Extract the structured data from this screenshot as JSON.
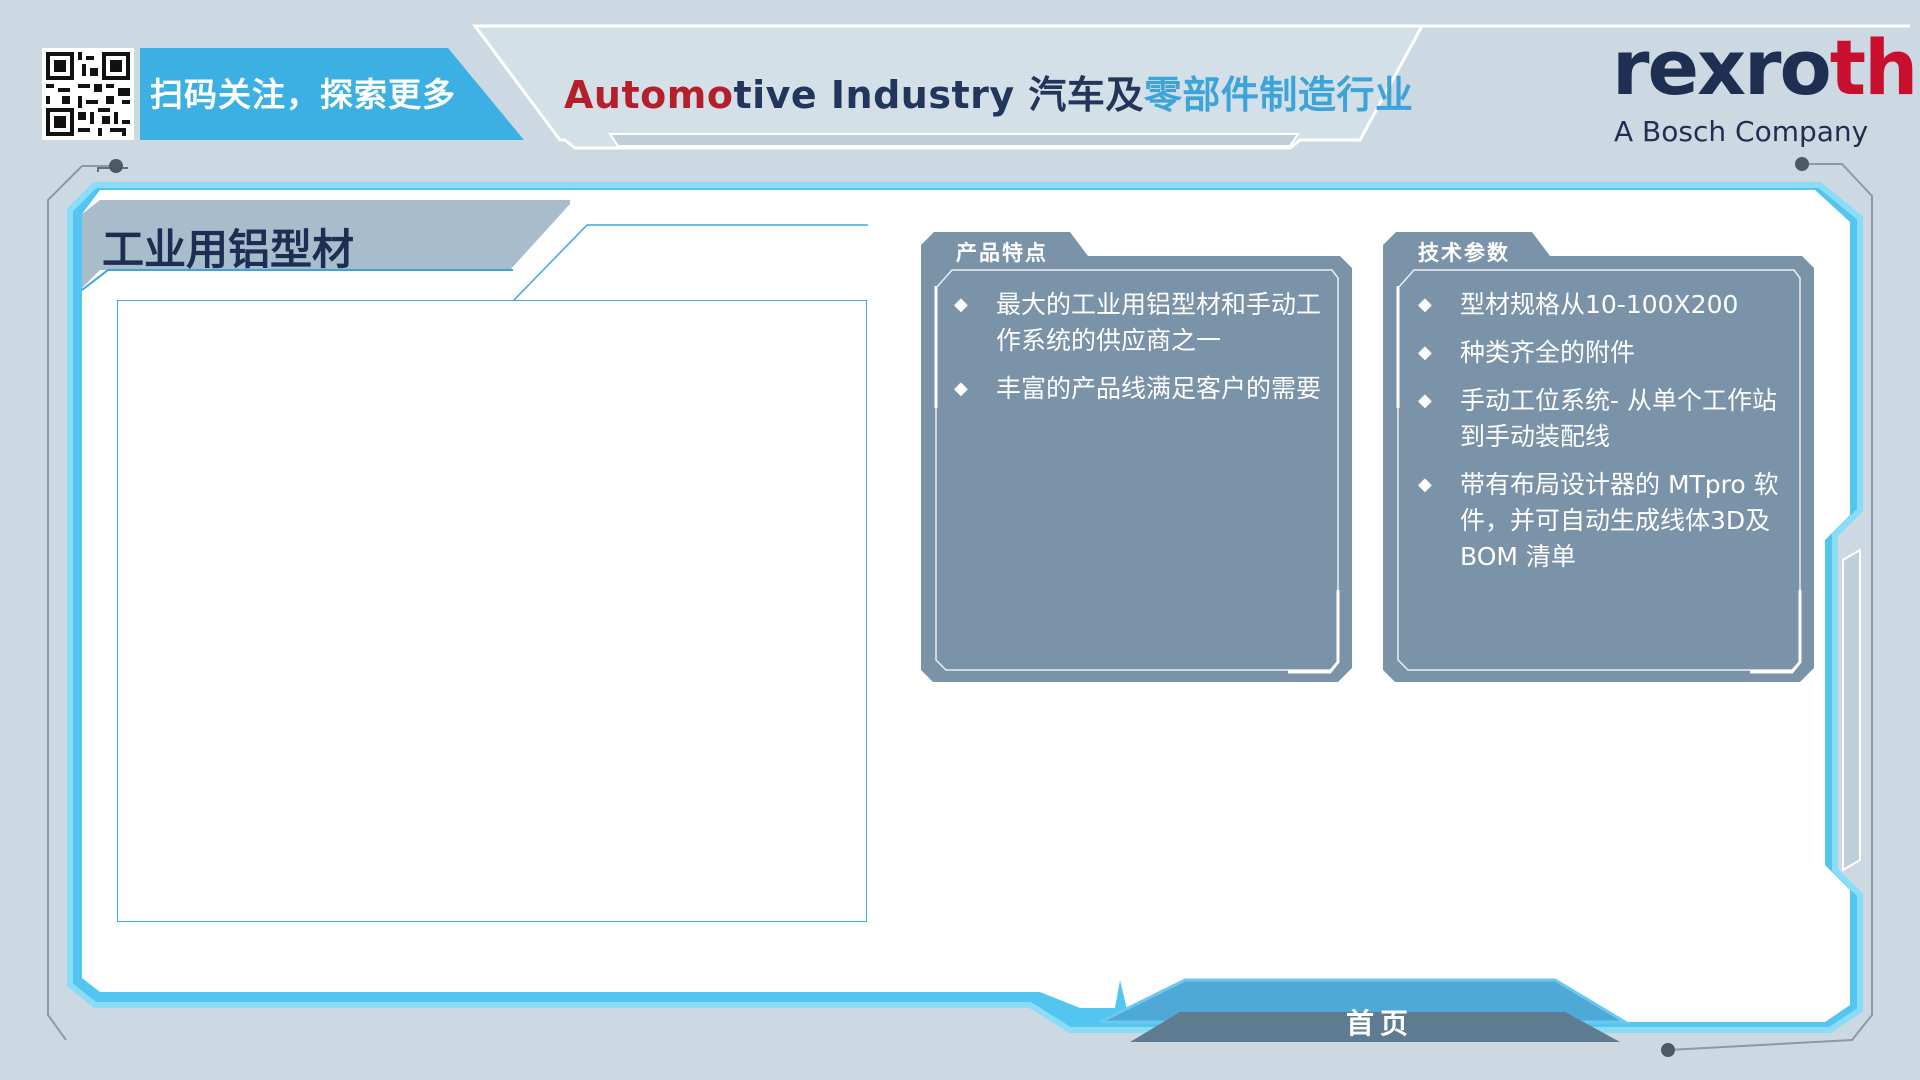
{
  "header": {
    "qr_label": "扫码关注，探索更多",
    "title_part_automo": "Automo",
    "title_part_tive": "tive Industry ",
    "title_part_cn1": "汽车及",
    "title_part_cn2": "零部件制造行业"
  },
  "logo": {
    "word_part1": "rexro",
    "word_part2": "th",
    "tagline": "A Bosch Company"
  },
  "main": {
    "title": "工业用铝型材"
  },
  "cards": [
    {
      "tab": "产品特点",
      "items": [
        "最大的工业用铝型材和手动工作系统的供应商之一",
        "丰富的产品线满足客户的需要"
      ]
    },
    {
      "tab": "技术参数",
      "items": [
        "型材规格从10-100X200",
        "种类齐全的附件",
        "手动工位系统- 从单个工作站到手动装配线",
        "带有布局设计器的 MTpro 软件，并可自动生成线体3D及BOM 清单"
      ]
    }
  ],
  "bullet_glyph": "◆",
  "footer": {
    "home_label": "首页"
  },
  "colors": {
    "background": "#cdd9e2",
    "accent_blue": "#3aa6de",
    "frame_glow": "#52c6f0",
    "navy": "#1c2f52",
    "card_fill": "#7a93a8",
    "brand_red": "#c8102e"
  }
}
